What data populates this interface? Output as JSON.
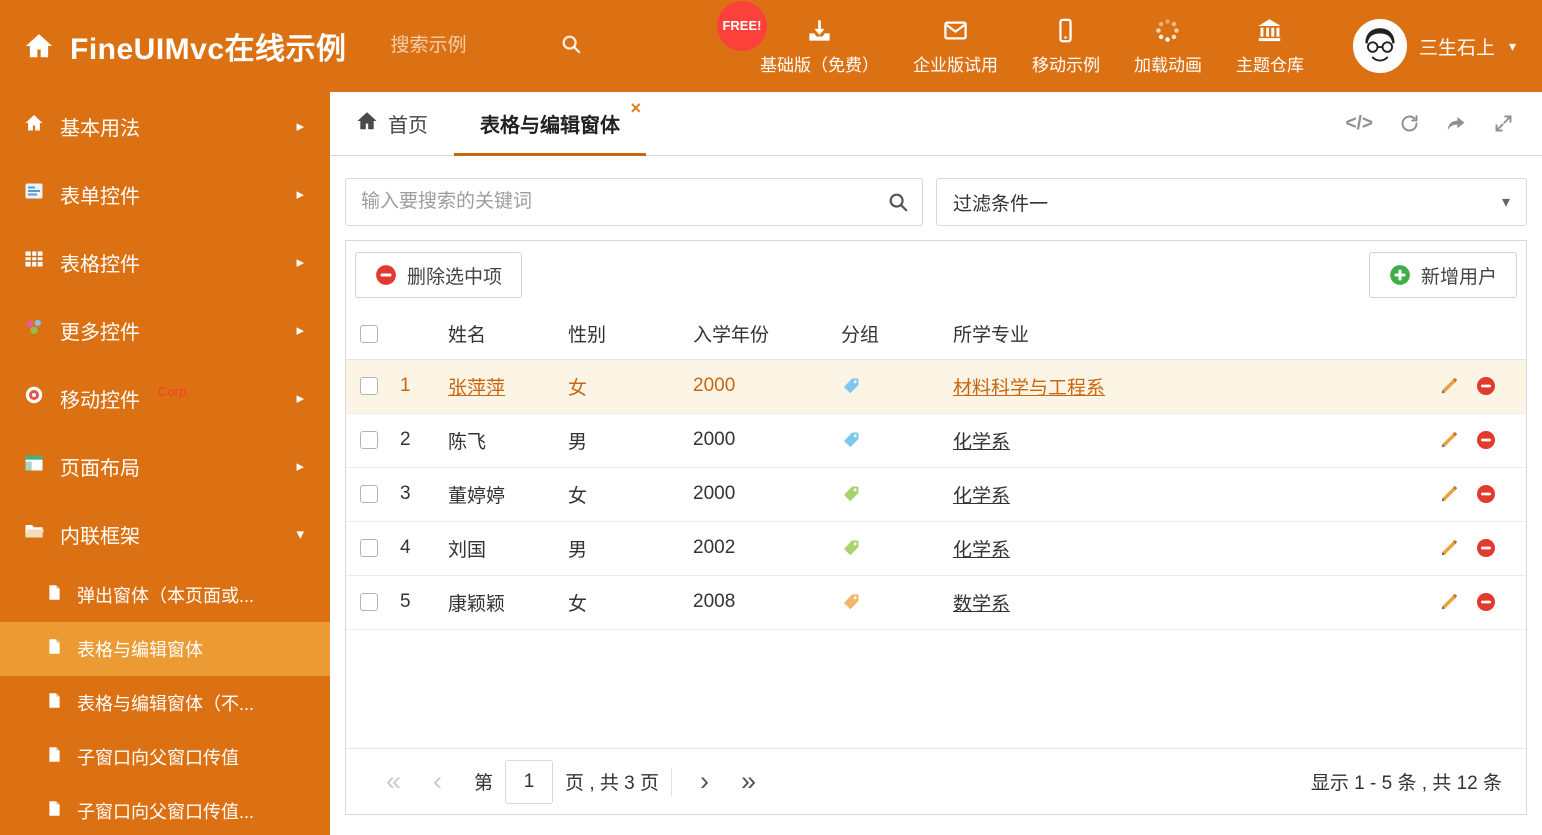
{
  "colors": {
    "theme_orange": "#DC7113",
    "active_item_bg": "#EC9A33",
    "accent_link": "#C9660F",
    "selected_row_bg": "#FCF5E6",
    "free_badge_bg": "#FB4139"
  },
  "header": {
    "title": "FineUIMvc在线示例",
    "search_placeholder": "搜索示例",
    "free_badge": "FREE!",
    "nav": [
      {
        "icon": "download-icon",
        "label": "基础版（免费）"
      },
      {
        "icon": "envelope-icon",
        "label": "企业版试用"
      },
      {
        "icon": "mobile-icon",
        "label": "移动示例"
      },
      {
        "icon": "spinner-icon",
        "label": "加载动画"
      },
      {
        "icon": "bank-icon",
        "label": "主题仓库"
      }
    ],
    "user_name": "三生石上"
  },
  "sidebar": {
    "items": [
      {
        "icon": "home-icon",
        "label": "基本用法"
      },
      {
        "icon": "form-icon",
        "label": "表单控件"
      },
      {
        "icon": "table-icon",
        "label": "表格控件"
      },
      {
        "icon": "widgets-icon",
        "label": "更多控件"
      },
      {
        "icon": "mobile-icon",
        "label": "移动控件",
        "badge": "Corp."
      },
      {
        "icon": "layout-icon",
        "label": "页面布局"
      },
      {
        "icon": "folder-icon",
        "label": "内联框架"
      }
    ],
    "subitems": [
      {
        "icon": "file-icon",
        "label": "弹出窗体（本页面或..."
      },
      {
        "icon": "file-icon",
        "label": "表格与编辑窗体"
      },
      {
        "icon": "file-icon",
        "label": "表格与编辑窗体（不..."
      },
      {
        "icon": "file-icon",
        "label": "子窗口向父窗口传值"
      },
      {
        "icon": "file-icon",
        "label": "子窗口向父窗口传值..."
      }
    ]
  },
  "tabs": {
    "home_label": "首页",
    "active_label": "表格与编辑窗体"
  },
  "filterbar": {
    "search_placeholder": "输入要搜索的关键词",
    "filter_value": "过滤条件一"
  },
  "toolbar": {
    "delete_label": "删除选中项",
    "add_label": "新增用户"
  },
  "table": {
    "headers": {
      "name": "姓名",
      "gender": "性别",
      "year": "入学年份",
      "group": "分组",
      "major": "所学专业"
    },
    "rows": [
      {
        "num": "1",
        "name": "张萍萍",
        "gender": "女",
        "year": "2000",
        "tag_color": "#7EC8EF",
        "major": "材料科学与工程系",
        "selected": true
      },
      {
        "num": "2",
        "name": "陈飞",
        "gender": "男",
        "year": "2000",
        "tag_color": "#7EC8EF",
        "major": "化学系",
        "selected": false
      },
      {
        "num": "3",
        "name": "董婷婷",
        "gender": "女",
        "year": "2000",
        "tag_color": "#A9D36E",
        "major": "化学系",
        "selected": false
      },
      {
        "num": "4",
        "name": "刘国",
        "gender": "男",
        "year": "2002",
        "tag_color": "#A9D36E",
        "major": "化学系",
        "selected": false
      },
      {
        "num": "5",
        "name": "康颖颖",
        "gender": "女",
        "year": "2008",
        "tag_color": "#F4B469",
        "major": "数学系",
        "selected": false
      }
    ]
  },
  "pagination": {
    "label_page": "第",
    "current_page": "1",
    "label_total": "页 , 共 3 页",
    "summary": "显示 1 - 5 条 , 共 12 条"
  },
  "icons": {
    "caret_down": "▾",
    "arrow_right": "▸",
    "close": "×",
    "code": "</>",
    "first": "«",
    "prev": "‹",
    "next": "›",
    "last": "»"
  }
}
